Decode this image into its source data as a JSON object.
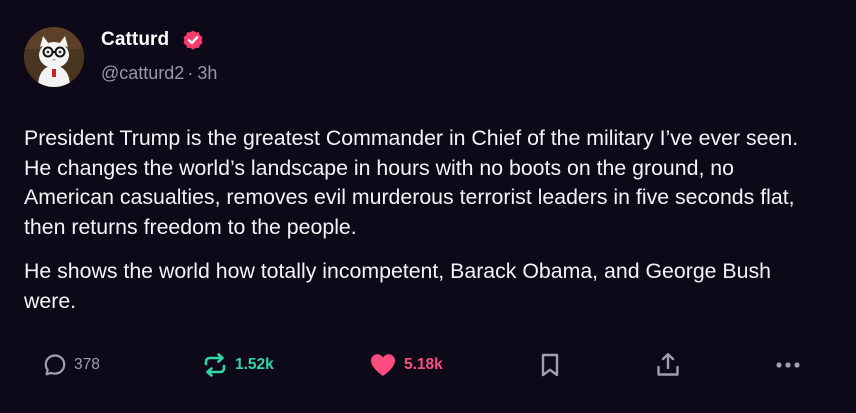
{
  "author": {
    "display_name": "Catturd",
    "handle": "@catturd2",
    "separator": "·",
    "time_ago": "3h",
    "verified": true,
    "avatar_icon": "cat-with-glasses-avatar"
  },
  "post": {
    "paragraphs": [
      "President Trump is the greatest Commander in Chief of the military I’ve ever seen. He changes the world’s landscape in hours with no boots on the ground, no American casualties, removes evil murderous terrorist leaders in five seconds flat, then returns freedom to the people.",
      "He shows the world how totally incompetent, Barack Obama, and George Bush were."
    ]
  },
  "actions": {
    "replies": "378",
    "reposts": "1.52k",
    "likes": "5.18k",
    "icons": [
      "reply-icon",
      "repost-icon",
      "heart-icon",
      "bookmark-icon",
      "share-icon",
      "more-icon"
    ]
  },
  "colors": {
    "background": "#0d0918",
    "verified": "#ff3d6e",
    "repost_active": "#2fd6a6",
    "like_active": "#ff4d7f",
    "muted": "#9c97a8"
  }
}
